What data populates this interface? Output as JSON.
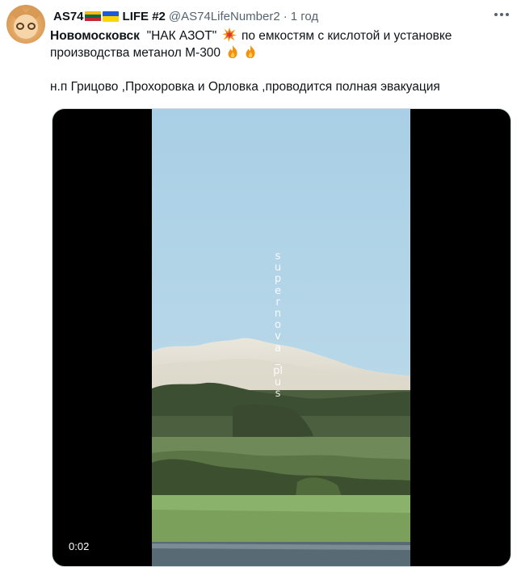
{
  "tweet": {
    "display_name": "AS74",
    "name_suffix": "LIFE #2",
    "handle": "@AS74LifeNumber2",
    "separator": "·",
    "time": "1 год",
    "text": {
      "line1_bold": "Новомосковск",
      "line1_quote": "\"НАК АЗОТ\"",
      "line1_rest": "по емкостям с кислотой и установке производства метанол М-300",
      "line2": "н.п Грицово ,Прохоровка и Орловка ,проводится полная эвакуация"
    },
    "icons": {
      "flag1": "lithuania-flag-icon",
      "flag2": "ukraine-flag-icon",
      "emoji_collision": "collision-emoji-icon",
      "emoji_fire": "fire-emoji-icon",
      "more": "more-options-icon"
    }
  },
  "media": {
    "watermark": "supernova_plus",
    "video_time": "0:02"
  }
}
